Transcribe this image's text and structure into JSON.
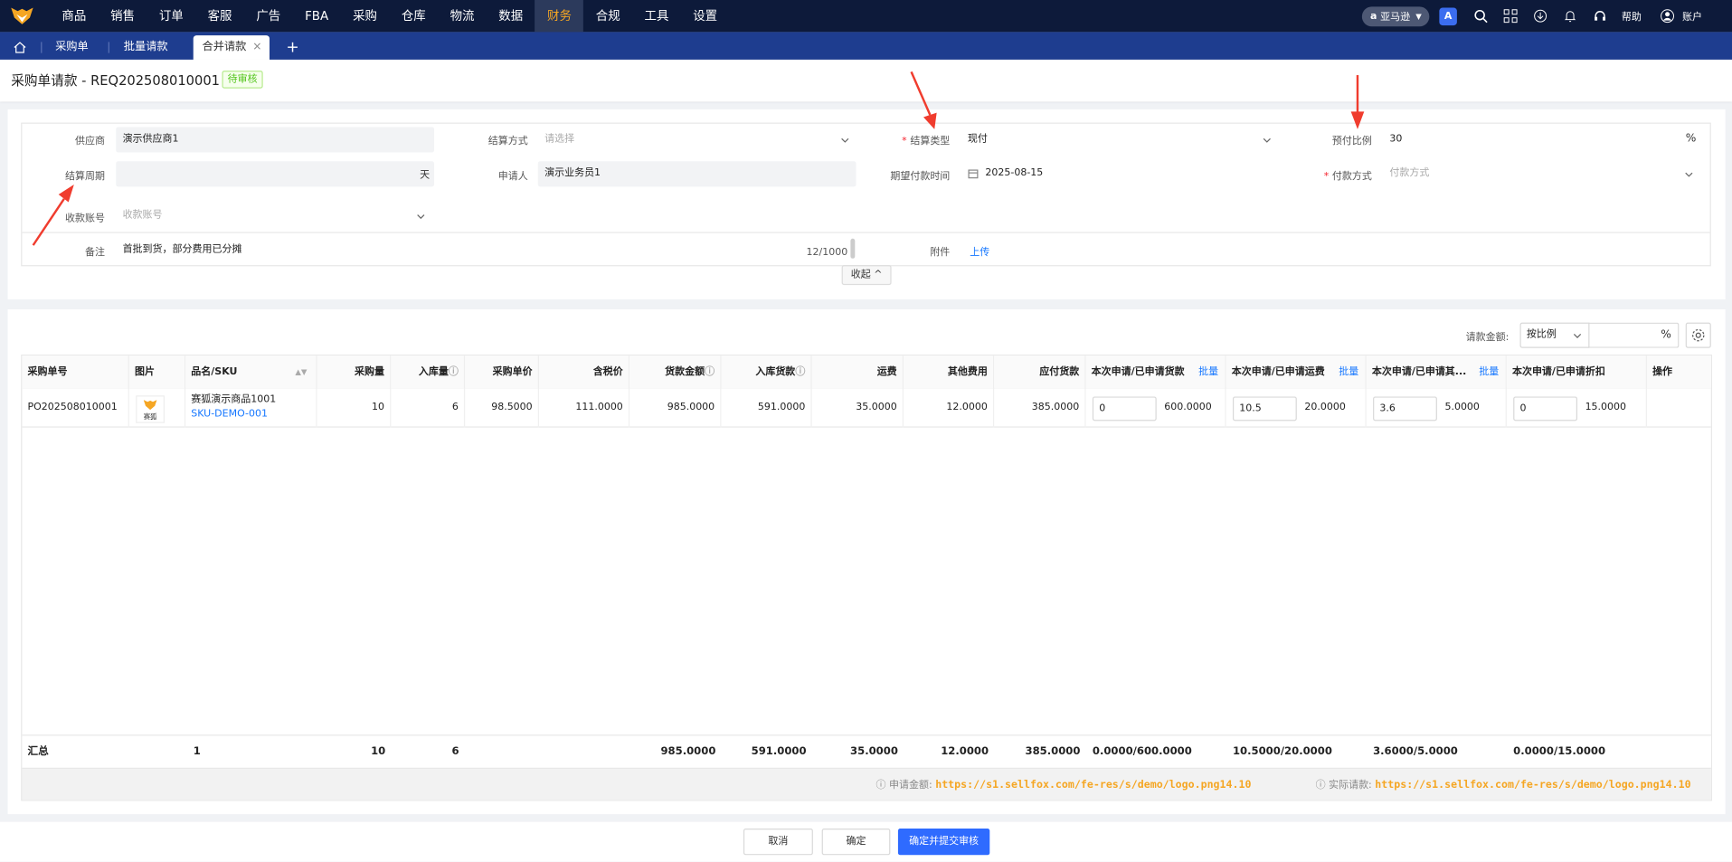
{
  "nav": {
    "items": [
      "商品",
      "销售",
      "订单",
      "客服",
      "广告",
      "FBA",
      "采购",
      "仓库",
      "物流",
      "数据",
      "财务",
      "合规",
      "工具",
      "设置"
    ],
    "active": "财务",
    "marketplace": "亚马逊",
    "help": "帮助",
    "account": "账户"
  },
  "tabs": {
    "items": [
      "采购单",
      "批量请款",
      "合并请款"
    ]
  },
  "header": {
    "title": "采购单请款 - REQ202508010001",
    "status": "待审核"
  },
  "form": {
    "supplier_label": "供应商",
    "supplier_value": "演示供应商1",
    "settle_method_label": "结算方式",
    "settle_method_placeholder": "请选择",
    "settle_type_label": "结算类型",
    "settle_type_value": "现付",
    "prepay_ratio_label": "预付比例",
    "prepay_ratio_value": "30",
    "prepay_ratio_unit": "%",
    "settle_period_label": "结算周期",
    "settle_period_unit": "天",
    "applicant_label": "申请人",
    "applicant_value": "演示业务员1",
    "expected_pay_label": "期望付款时间",
    "expected_pay_value": "2025-08-15",
    "pay_method_label": "付款方式",
    "pay_method_placeholder": "付款方式",
    "account_label": "收款账号",
    "account_placeholder": "收款账号",
    "remark_label": "备注",
    "remark_value": "首批到货，部分费用已分摊",
    "remark_count": "12/1000",
    "attachment_label": "附件",
    "upload_label": "上传",
    "collapse_label": "收起"
  },
  "table": {
    "amount_label": "请款金额:",
    "amount_mode": "按比例",
    "amount_unit": "%",
    "batch_label": "批量",
    "headers": [
      "采购单号",
      "图片",
      "品名/SKU",
      "采购量",
      "入库量",
      "采购单价",
      "含税价",
      "货款金额",
      "入库货款",
      "运费",
      "其他费用",
      "应付货款",
      "本次申请/已申请货款",
      "本次申请/已申请运费",
      "本次申请/已申请其...",
      "本次申请/已申请折扣",
      "操作"
    ],
    "row": {
      "po": "PO202508010001",
      "img_text": "赛狐",
      "name": "赛狐演示商品1001",
      "sku": "SKU-DEMO-001",
      "qty": "10",
      "in_qty": "6",
      "unit_price": "98.5000",
      "tax_price": "111.0000",
      "amount": "985.0000",
      "in_amount": "591.0000",
      "freight": "35.0000",
      "other": "12.0000",
      "payable": "385.0000",
      "cur_goods": "0",
      "applied_goods": "600.0000",
      "cur_freight": "10.5",
      "applied_freight": "20.0000",
      "cur_other": "3.6",
      "applied_other": "5.0000",
      "cur_discount": "0",
      "applied_discount": "15.0000"
    },
    "summary": {
      "label": "汇总",
      "count": "1",
      "qty": "10",
      "in_qty": "6",
      "amount": "985.0000",
      "in_amount": "591.0000",
      "freight": "35.0000",
      "other": "12.0000",
      "payable": "385.0000",
      "goods": "0.0000/600.0000",
      "freight_ap": "10.5000/20.0000",
      "other_ap": "3.6000/5.0000",
      "discount_ap": "0.0000/15.0000"
    },
    "footer": {
      "apply_label": "申请金额:",
      "apply_value": "https://s1.sellfox.com/fe-res/s/demo/logo.png14.10",
      "actual_label": "实际请款:",
      "actual_value": "https://s1.sellfox.com/fe-res/s/demo/logo.png14.10"
    }
  },
  "buttons": {
    "cancel": "取消",
    "confirm": "确定",
    "submit": "确定并提交审核"
  },
  "colors": {
    "topbar": "#0d1a3a",
    "tabbar": "#1e3d8f",
    "accent": "#f5a623",
    "primary": "#2f6bff",
    "annotation": "#f03c2e"
  }
}
